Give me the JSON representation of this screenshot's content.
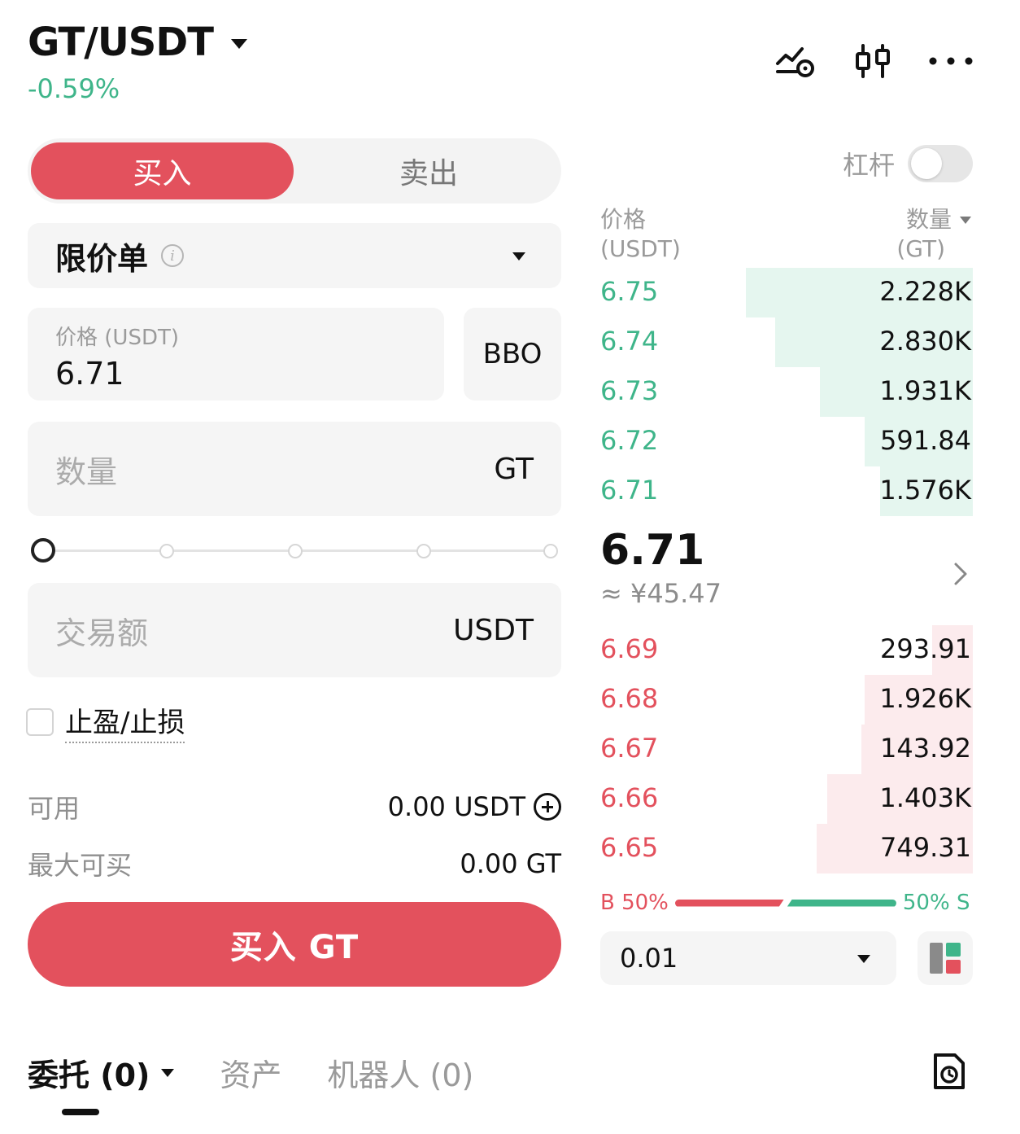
{
  "header": {
    "pair": "GT/USDT",
    "change": "-0.59%",
    "icons": [
      "chart-alert-icon",
      "candlestick-icon",
      "more-icon"
    ]
  },
  "trade": {
    "tabs": {
      "buy": "买入",
      "sell": "卖出"
    },
    "order_type": "限价单",
    "price_label": "价格 (USDT)",
    "price_value": "6.71",
    "bbo_label": "BBO",
    "quantity_placeholder": "数量",
    "quantity_unit": "GT",
    "slider_percent": 0,
    "amount_placeholder": "交易额",
    "amount_unit": "USDT",
    "tpsl_label": "止盈/止损",
    "available_label": "可用",
    "available_value": "0.00 USDT",
    "max_buy_label": "最大可买",
    "max_buy_value": "0.00 GT",
    "submit_label": "买入 GT"
  },
  "orderbook": {
    "leverage_label": "杠杆",
    "leverage_on": false,
    "price_header": "价格",
    "price_unit": "(USDT)",
    "qty_header": "数量",
    "qty_unit": "(GT)",
    "asks": [
      {
        "price": "6.75",
        "qty": "2.228K",
        "depth": 0.61
      },
      {
        "price": "6.74",
        "qty": "2.830K",
        "depth": 0.53
      },
      {
        "price": "6.73",
        "qty": "1.931K",
        "depth": 0.41
      },
      {
        "price": "6.72",
        "qty": "591.84",
        "depth": 0.29
      },
      {
        "price": "6.71",
        "qty": "1.576K",
        "depth": 0.25
      }
    ],
    "last_price": "6.71",
    "fiat_price": "≈ ¥45.47",
    "bids": [
      {
        "price": "6.69",
        "qty": "293.91",
        "depth": 0.11
      },
      {
        "price": "6.68",
        "qty": "1.926K",
        "depth": 0.29
      },
      {
        "price": "6.67",
        "qty": "143.92",
        "depth": 0.3
      },
      {
        "price": "6.66",
        "qty": "1.403K",
        "depth": 0.39
      },
      {
        "price": "6.65",
        "qty": "749.31",
        "depth": 0.42
      }
    ],
    "buy_ratio_label": "B 50%",
    "sell_ratio_label": "50% S",
    "buy_ratio": 0.5,
    "precision": "0.01"
  },
  "bottom_tabs": {
    "orders": "委托 (0)",
    "assets": "资产",
    "bots": "机器人 (0)"
  },
  "colors": {
    "buy": "#e3515d",
    "sell": "#3fb58a"
  }
}
